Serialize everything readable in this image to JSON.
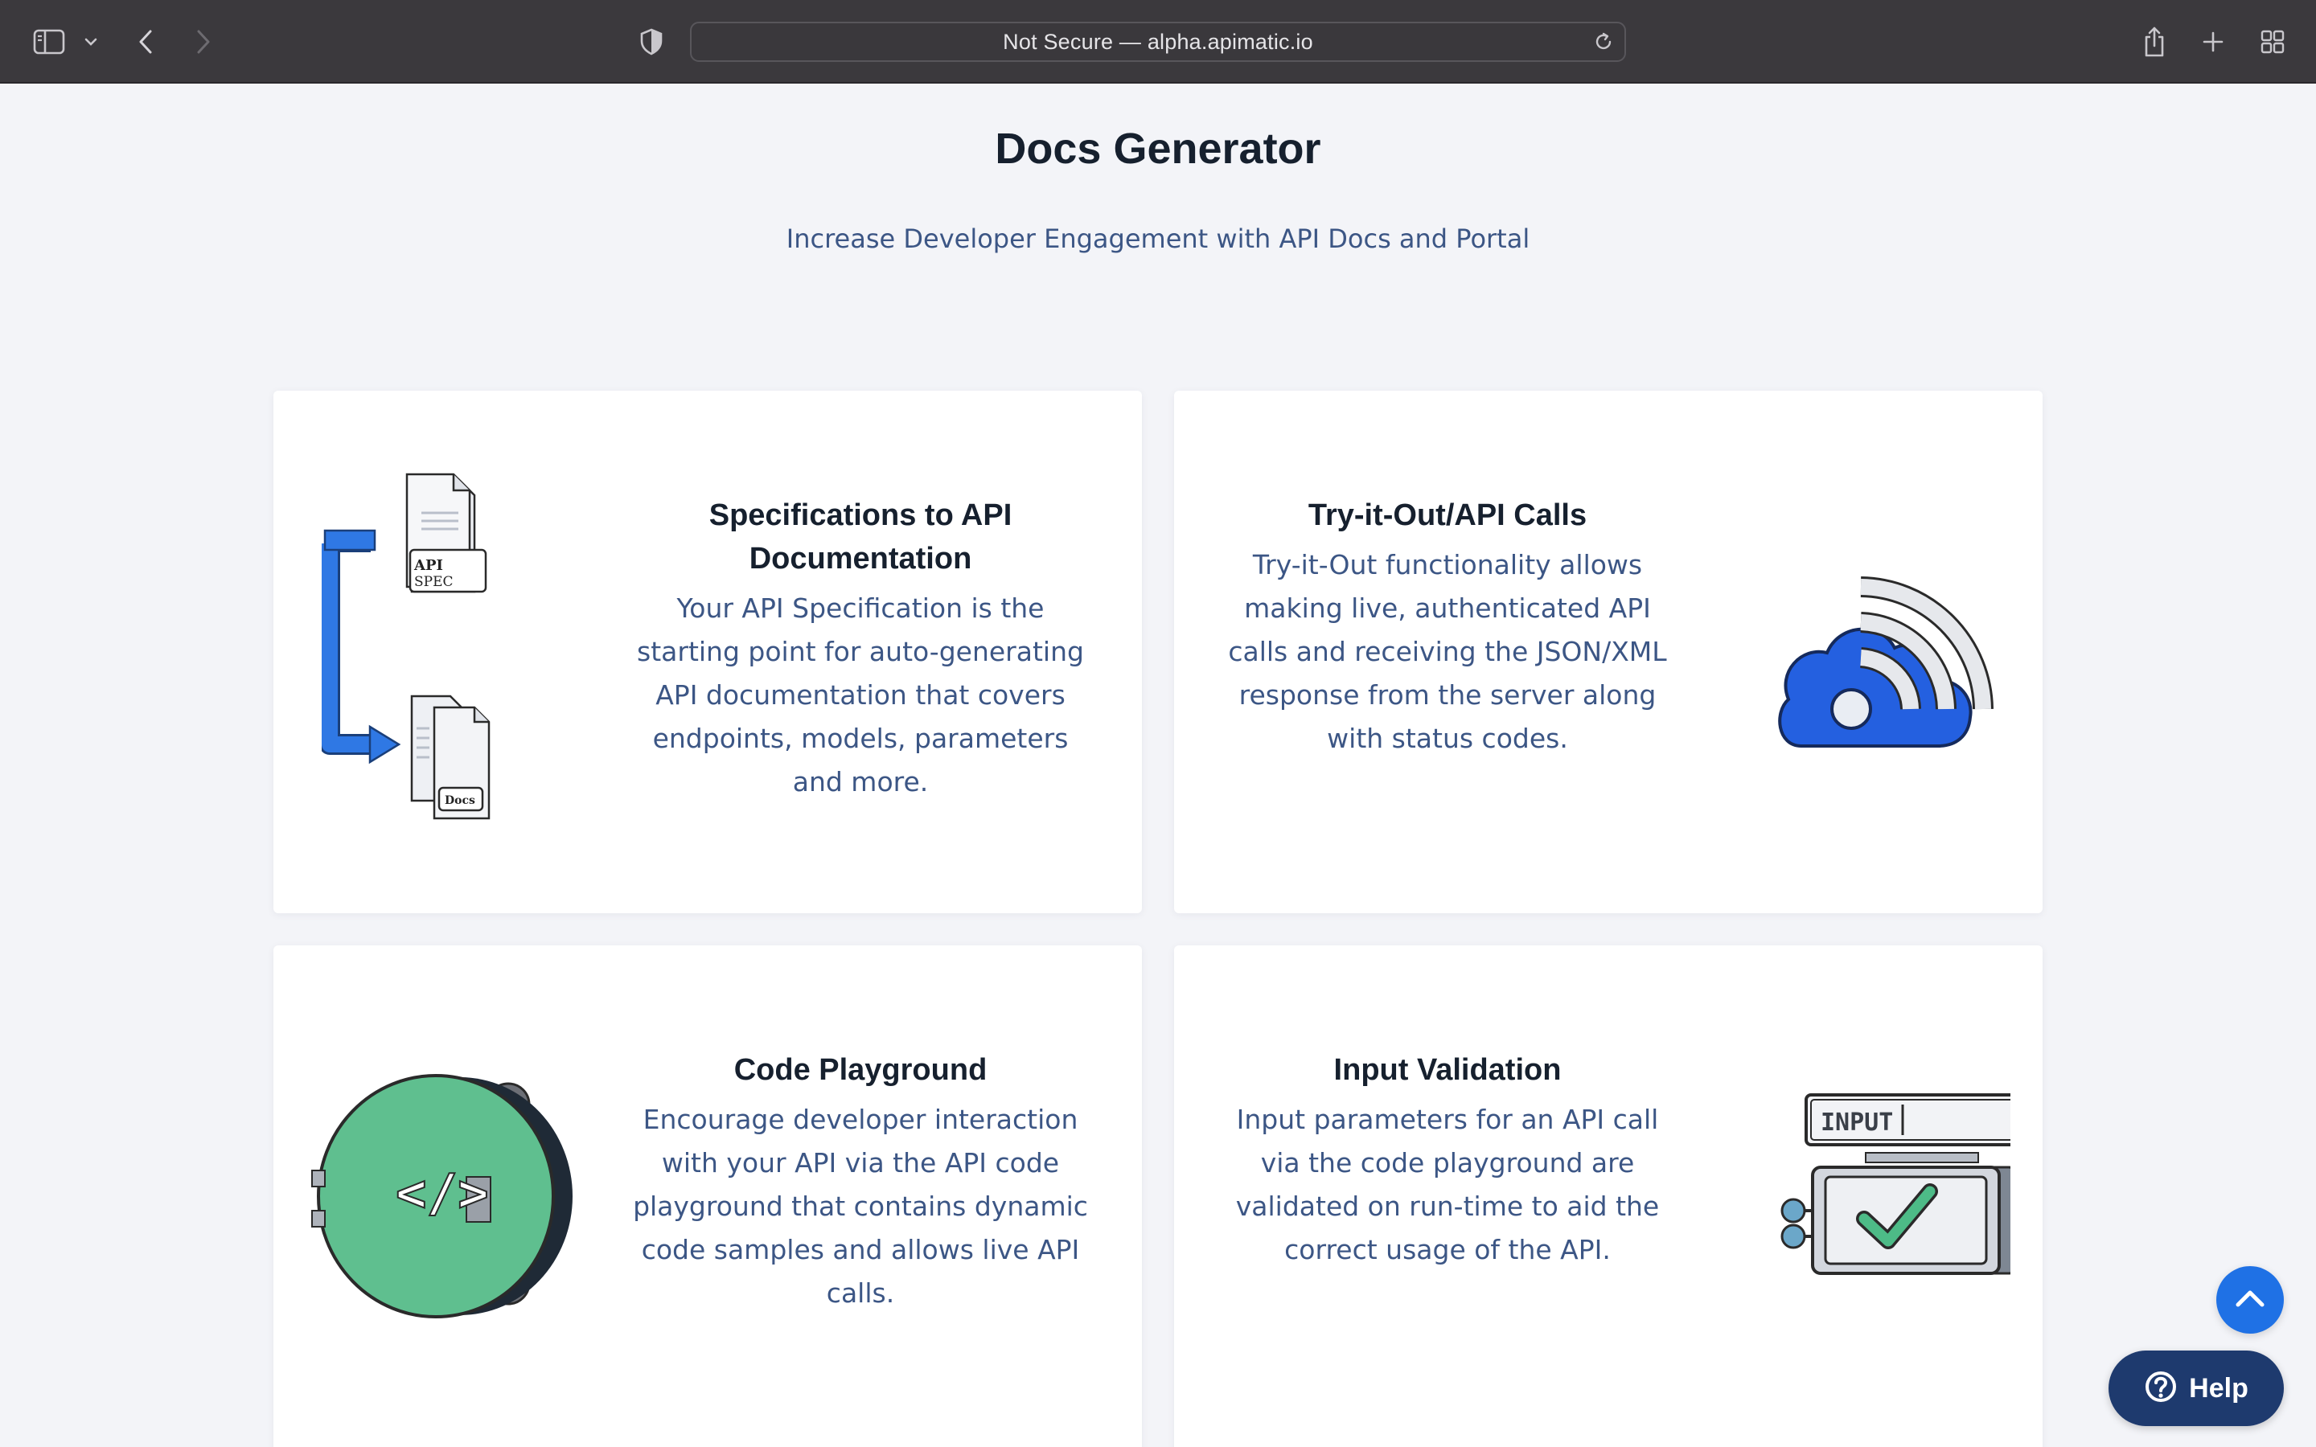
{
  "browser": {
    "address": "Not Secure — alpha.apimatic.io",
    "icons": [
      "sidebar-icon",
      "chevron-down-icon",
      "back-icon",
      "forward-icon",
      "shield-icon",
      "reload-icon",
      "share-icon",
      "new-tab-icon",
      "tab-overview-icon"
    ]
  },
  "page": {
    "title": "Docs Generator",
    "subtitle": "Increase Developer Engagement with API Docs and Portal"
  },
  "cards": [
    {
      "title": "Specifications to API Documentation",
      "description": "Your API Specification is the starting point for auto-generating API documentation that covers endpoints, models, parameters and more.",
      "illustration": {
        "name": "spec-to-docs-icon",
        "label_api": "API",
        "label_spec": "SPEC",
        "label_docs": "Docs"
      }
    },
    {
      "title": "Try-it-Out/API Calls",
      "description": "Try-it-Out functionality allows making live, authenticated API calls and receiving the JSON/XML response from the server along with status codes.",
      "illustration": {
        "name": "cloud-signal-icon"
      }
    },
    {
      "title": "Code Playground",
      "description": "Encourage developer interaction with your API via the API code playground that contains dynamic code samples and allows live API calls.",
      "illustration": {
        "name": "code-disc-icon",
        "code_glyph": "</>"
      }
    },
    {
      "title": "Input Validation",
      "description": "Input parameters for an API call via the code playground are validated on run-time to aid the correct usage of the API.",
      "illustration": {
        "name": "input-validation-icon",
        "label_input": "INPUT"
      }
    }
  ],
  "floating": {
    "help_label": "Help",
    "scroll_top_icon": "chevron-up-icon",
    "help_icon": "question-circle-icon"
  },
  "colors": {
    "toolbar": "#3b393d",
    "page_bg": "#f3f4f8",
    "title": "#16202e",
    "body_text": "#3c5685",
    "accent_blue": "#1f71e5",
    "help_bg": "#1e3a6e",
    "green": "#5fbf8f"
  }
}
